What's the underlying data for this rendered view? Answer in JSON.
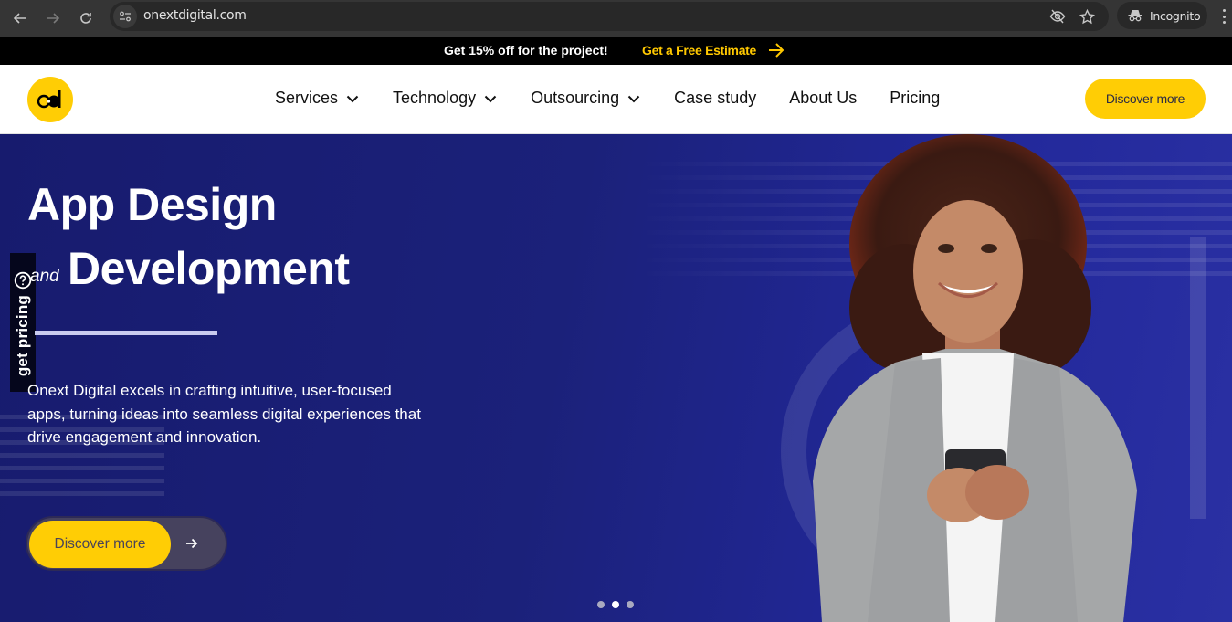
{
  "browser": {
    "url": "onextdigital.com",
    "profile_label": "Incognito",
    "icons": [
      "back-arrow-icon",
      "forward-arrow-icon",
      "reload-icon",
      "site-info-icon",
      "eye-off-icon",
      "star-icon",
      "incognito-icon",
      "more-vert-icon"
    ]
  },
  "promo": {
    "text": "Get 15% off for the project!",
    "link_label": "Get a Free Estimate",
    "accent_color": "#ffc800"
  },
  "header": {
    "logo_alt": "Onext Digital logo",
    "nav": [
      {
        "label": "Services",
        "has_dropdown": true
      },
      {
        "label": "Technology",
        "has_dropdown": true
      },
      {
        "label": "Outsourcing",
        "has_dropdown": true
      },
      {
        "label": "Case study",
        "has_dropdown": false
      },
      {
        "label": "About Us",
        "has_dropdown": false
      },
      {
        "label": "Pricing",
        "has_dropdown": false
      }
    ],
    "cta_label": "Discover more",
    "brand_color": "#ffcd05"
  },
  "hero": {
    "title_line1": "App Design",
    "title_connector": "and",
    "title_line2": "Development",
    "description": "Onext Digital excels in crafting intuitive, user-focused apps, turning ideas into seamless digital experiences that drive engagement and innovation.",
    "cta_label": "Discover more",
    "side_tab_label": "get pricing",
    "slider": {
      "total": 3,
      "active_index": 1
    },
    "background_color": "#1b217a"
  }
}
